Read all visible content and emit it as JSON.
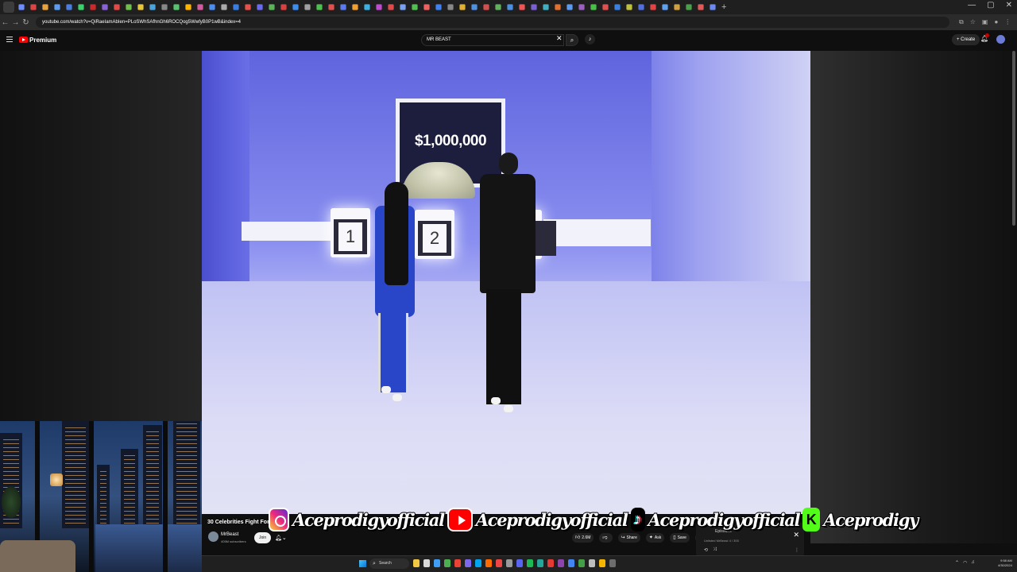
{
  "browser": {
    "url": "youtube.com/watch?v=QiRaeIamAbIen=PLoSWhSAfhnGh6ROCQog5WwfyB0P1wB&index=4",
    "url_domain": "youtube.com",
    "tab_colors": [
      "#6c8cff",
      "#d44",
      "#e8a33c",
      "#5b9cf0",
      "#4a7de0",
      "#3ccf6e",
      "#cc2a2a",
      "#8a62d8",
      "#e24a4a",
      "#6fbf4a",
      "#e6c53a",
      "#4aa3df",
      "#888",
      "#58c26e",
      "#ffb400",
      "#d15b9c",
      "#4c8ef0",
      "#aaa",
      "#3a7de0",
      "#e4504a",
      "#6a6af0",
      "#59b359",
      "#d94040",
      "#3f8cf0",
      "#a0a0a0",
      "#4ec04e",
      "#e05050",
      "#5a7bf0",
      "#f0a030",
      "#3cb0e0",
      "#c04bd0",
      "#e04a4a",
      "#7aa0f0",
      "#50c050",
      "#f06060",
      "#4080f0",
      "#888",
      "#e0b030",
      "#5090e0",
      "#d05050",
      "#60b060",
      "#4a90e2",
      "#e55",
      "#7a60d0",
      "#40b0c0",
      "#e07030",
      "#5a9af0",
      "#9a60c0",
      "#48c048",
      "#e05050",
      "#3a80e0",
      "#c0c040",
      "#5070e0",
      "#e04444",
      "#60a0f0",
      "#d0a040",
      "#4aa04a",
      "#e05a5a",
      "#6a8af0"
    ],
    "window_controls": [
      "—",
      "▢",
      "✕"
    ],
    "new_tab": "+"
  },
  "youtube": {
    "logo_label": "Premium",
    "search_query": "MR BEAST",
    "create_label": "Create"
  },
  "video": {
    "screen_text": "$1,000,000",
    "podium_1": "1",
    "podium_2": "2",
    "title": "30 Celebrities Fight For $",
    "channel_name": "MrBeast",
    "subscribers": "405M subscribers",
    "join_label": "Join",
    "likes": "2.6M",
    "share_label": "Share",
    "ask_label": "Ask",
    "save_label": "Save"
  },
  "overlay": {
    "handle_instagram": "Aceprodigyofficial",
    "handle_youtube": "Aceprodigyofficial",
    "handle_tiktok": "Aceprodigyofficial",
    "handle_kick": "Aceprodigy",
    "kick_letter": "K"
  },
  "miniplaylist": {
    "title": "Episodes",
    "meta_left": "Unlisted",
    "meta_channel": "MrBeast",
    "meta_count": "4 / 300"
  },
  "taskbar": {
    "search_label": "Search",
    "time": "9:58 AM",
    "date": "4/30/2024",
    "app_colors": [
      "#f2c744",
      "#d9d9d9",
      "#3da0f5",
      "#4caf50",
      "#ea4335",
      "#7b68ee",
      "#00a4ef",
      "#ff6a00",
      "#e44",
      "#999",
      "#5865f2",
      "#1db954",
      "#26a69a",
      "#e53935",
      "#8e44ad",
      "#4285f4",
      "#43a047",
      "#bdbdbd",
      "#f4b400",
      "#6d6d6d"
    ]
  }
}
